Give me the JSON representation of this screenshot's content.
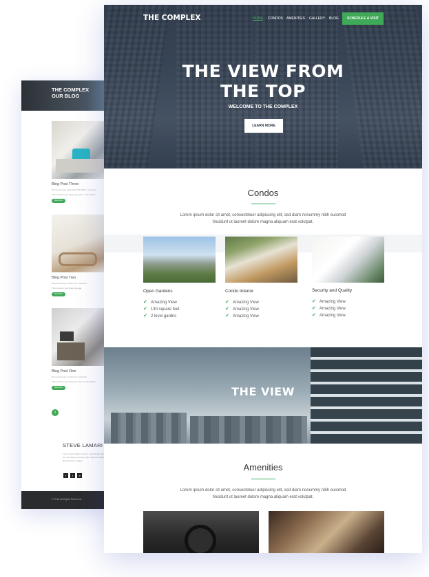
{
  "blog": {
    "header_line1": "THE COMPLEX",
    "header_line2": "OUR BLOG",
    "posts": [
      {
        "title": "Blog Post Three",
        "meta": "Nervous Henna | September 18th 2016 | 1 comment",
        "excerpt": "This is where your blog post goes. Lorem ipsum",
        "button": "Read More"
      },
      {
        "title": "Blog Post Two",
        "meta": "Nervous Henna | in Interior | 2 comments",
        "excerpt": "This is where your Blog list page",
        "button": "Read More"
      },
      {
        "title": "Blog Post One",
        "meta": "Nervous Henna | in Interior | 2 comments",
        "excerpt": "This is where your blog post goes. Lorem ipsum",
        "button": "Read More"
      }
    ],
    "page_number": "1",
    "author_name": "STEVE LAMARI",
    "author_bio": "Lorem ipsum dolor sit amet, consectetuer adipiscing elit, sed diam nonummy nibh euismod tincidunt ut laoreet dolore magna.",
    "social": [
      "f",
      "t",
      "in"
    ],
    "footer_copy": "© 2016 All Rights Reserved."
  },
  "header": {
    "logo": "THE COMPLEX",
    "nav": [
      "HOME",
      "CONDOS",
      "AMENITIES",
      "GALLERY",
      "BLOG"
    ],
    "cta": "SCHEDULE A VISIT"
  },
  "hero": {
    "title_line1": "THE VIEW FROM",
    "title_line2": "THE TOP",
    "subtitle": "WELCOME TO THE COMPLEX",
    "button": "LEARN MORE"
  },
  "condos": {
    "title": "Condos",
    "text_line1": "Lorem ipsum dolor sit amet, consectetuer adipiscing elit, sed diam nonummy nibh euismod",
    "text_line2": "tincidunt ut laoreet dolore magna aliquam erat volutpat.",
    "cards": [
      {
        "title": "Open Gardens",
        "features": [
          "Amazing View",
          "130 square feet",
          "2 level gardns"
        ]
      },
      {
        "title": "Condo Interior",
        "features": [
          "Amazing View",
          "Amazing View",
          "Amazing View"
        ]
      },
      {
        "title": "Security and Quality",
        "features": [
          "Amazing View",
          "Amazing View",
          "Amazing View"
        ]
      }
    ]
  },
  "view": {
    "title": "THE VIEW"
  },
  "amenities": {
    "title": "Amenities",
    "text_line1": "Lorem ipsum dolor sit amet, consectetuer adipiscing elit, sed diam nonummy nibh euismod",
    "text_line2": "tincidunt ut laoreet dolore magna aliquam erat volutpat."
  },
  "colors": {
    "accent": "#3fa957",
    "hero_overlay": "#3c4757",
    "footer": "#2a2c2e"
  }
}
